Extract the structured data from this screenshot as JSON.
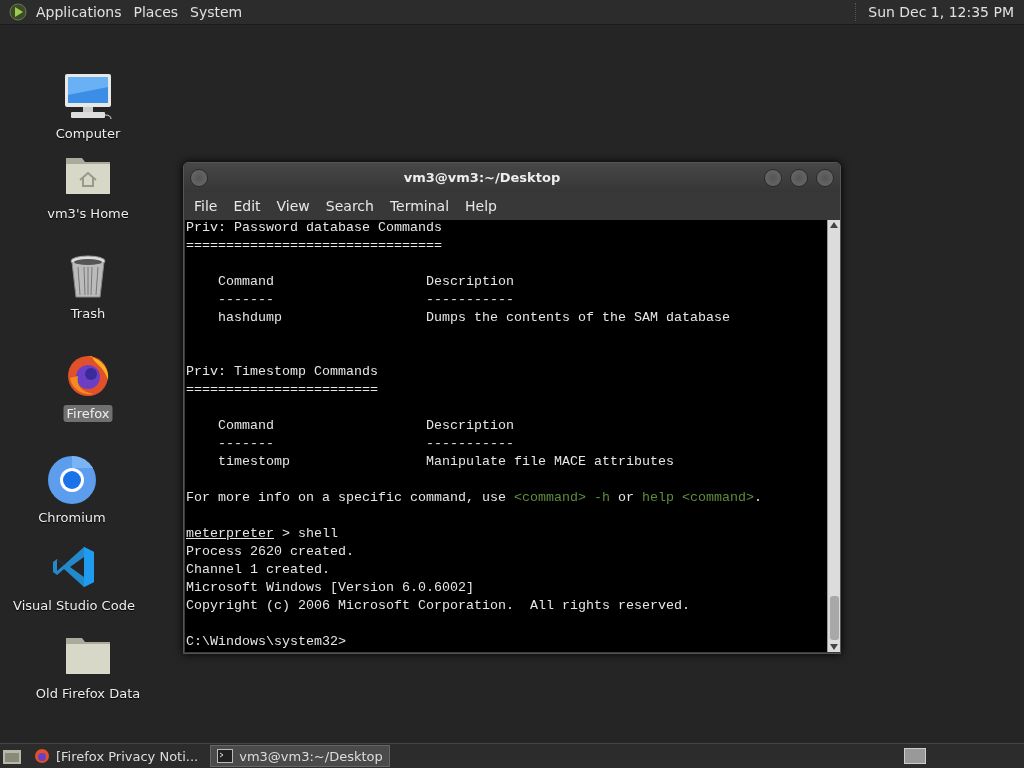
{
  "top_panel": {
    "menus": [
      "Applications",
      "Places",
      "System"
    ],
    "clock": "Sun Dec 1, 12:35 PM"
  },
  "desktop_icons": [
    {
      "label": "Computer",
      "selected": false
    },
    {
      "label": "vm3's Home",
      "selected": false
    },
    {
      "label": "Trash",
      "selected": false
    },
    {
      "label": "Firefox",
      "selected": true
    },
    {
      "label": "Chromium",
      "selected": false
    },
    {
      "label": "Visual Studio Code",
      "selected": false
    },
    {
      "label": "Old Firefox Data",
      "selected": false
    }
  ],
  "terminal_window": {
    "title": "vm3@vm3:~/Desktop",
    "menu": [
      "File",
      "Edit",
      "View",
      "Search",
      "Terminal",
      "Help"
    ],
    "lines": [
      {
        "kind": "text",
        "segments": [
          {
            "kind": "plain",
            "text": "Priv: Password database Commands"
          }
        ]
      },
      {
        "kind": "text",
        "segments": [
          {
            "kind": "plain",
            "text": "================================"
          }
        ]
      },
      {
        "kind": "blank"
      },
      {
        "kind": "text",
        "segments": [
          {
            "kind": "plain",
            "text": "    Command                   Description"
          }
        ]
      },
      {
        "kind": "text",
        "segments": [
          {
            "kind": "plain",
            "text": "    -------                   -----------"
          }
        ]
      },
      {
        "kind": "text",
        "segments": [
          {
            "kind": "plain",
            "text": "    hashdump                  Dumps the contents of the SAM database"
          }
        ]
      },
      {
        "kind": "blank"
      },
      {
        "kind": "blank"
      },
      {
        "kind": "text",
        "segments": [
          {
            "kind": "plain",
            "text": "Priv: Timestomp Commands"
          }
        ]
      },
      {
        "kind": "text",
        "segments": [
          {
            "kind": "plain",
            "text": "========================"
          }
        ]
      },
      {
        "kind": "blank"
      },
      {
        "kind": "text",
        "segments": [
          {
            "kind": "plain",
            "text": "    Command                   Description"
          }
        ]
      },
      {
        "kind": "text",
        "segments": [
          {
            "kind": "plain",
            "text": "    -------                   -----------"
          }
        ]
      },
      {
        "kind": "text",
        "segments": [
          {
            "kind": "plain",
            "text": "    timestomp                 Manipulate file MACE attributes"
          }
        ]
      },
      {
        "kind": "blank"
      },
      {
        "kind": "text",
        "segments": [
          {
            "kind": "plain",
            "text": "For more info on a specific command, use "
          },
          {
            "kind": "green",
            "text": "<command> -h"
          },
          {
            "kind": "plain",
            "text": " or "
          },
          {
            "kind": "green",
            "text": "help <command>"
          },
          {
            "kind": "plain",
            "text": "."
          }
        ]
      },
      {
        "kind": "blank"
      },
      {
        "kind": "text",
        "segments": [
          {
            "kind": "underline",
            "text": "meterpreter"
          },
          {
            "kind": "plain",
            "text": " > shell"
          }
        ]
      },
      {
        "kind": "text",
        "segments": [
          {
            "kind": "plain",
            "text": "Process 2620 created."
          }
        ]
      },
      {
        "kind": "text",
        "segments": [
          {
            "kind": "plain",
            "text": "Channel 1 created."
          }
        ]
      },
      {
        "kind": "text",
        "segments": [
          {
            "kind": "plain",
            "text": "Microsoft Windows [Version 6.0.6002]"
          }
        ]
      },
      {
        "kind": "text",
        "segments": [
          {
            "kind": "plain",
            "text": "Copyright (c) 2006 Microsoft Corporation.  All rights reserved."
          }
        ]
      },
      {
        "kind": "blank"
      },
      {
        "kind": "text",
        "segments": [
          {
            "kind": "plain",
            "text": "C:\\Windows\\system32>"
          }
        ]
      }
    ]
  },
  "taskbar": {
    "tasks": [
      {
        "label": "[Firefox Privacy Noti...",
        "selected": false
      },
      {
        "label": "vm3@vm3:~/Desktop",
        "selected": true
      }
    ]
  }
}
